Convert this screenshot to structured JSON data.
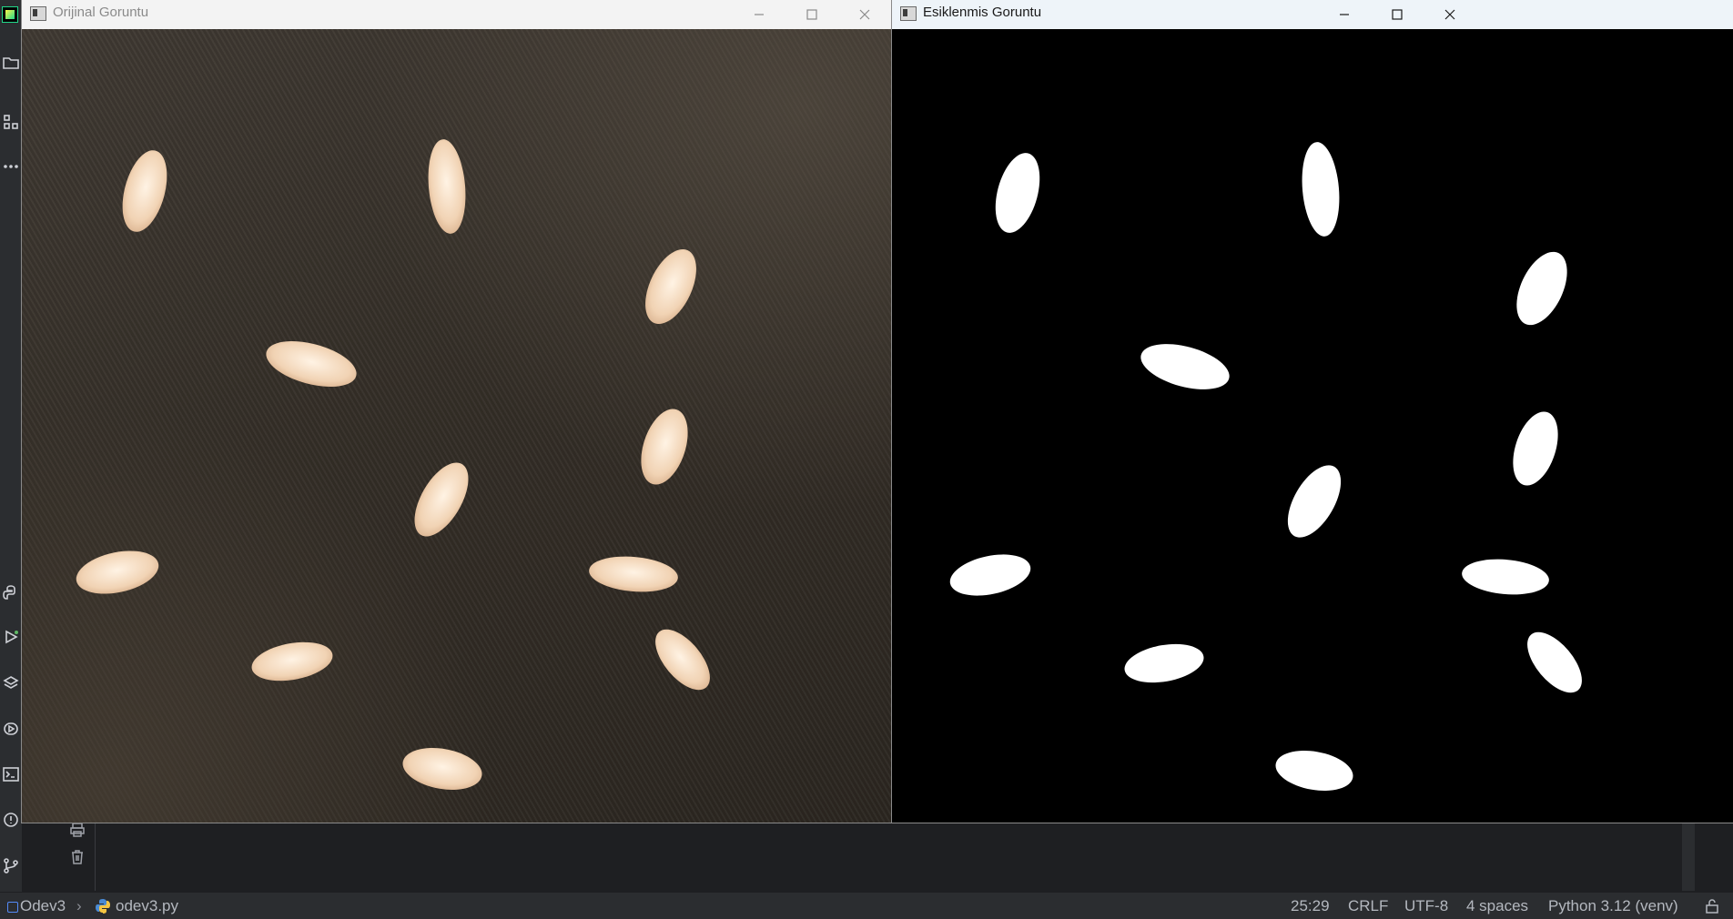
{
  "windows": {
    "original": {
      "title": "Orijinal Goruntu"
    },
    "threshold": {
      "title": "Esiklenmis Goruntu"
    }
  },
  "ide": {
    "left_tools": [
      "project-folder-icon",
      "structure-icon",
      "more-icon",
      "python-console-icon",
      "run-icon",
      "layers-icon",
      "services-icon",
      "terminal-icon",
      "problems-icon",
      "git-icon"
    ],
    "bottom_tools": [
      "print-icon",
      "trash-icon"
    ]
  },
  "statusbar": {
    "project": "Odev3",
    "file": "odev3.py",
    "caret": "25:29",
    "line_ending": "CRLF",
    "encoding": "UTF-8",
    "indent": "4 spaces",
    "interpreter": "Python 3.12 (venv)"
  },
  "colors": {
    "ide_bg": "#1e1f22",
    "panel_bg": "#2b2d30",
    "rice": "#f4dcc3",
    "mask": "#ffffff"
  }
}
